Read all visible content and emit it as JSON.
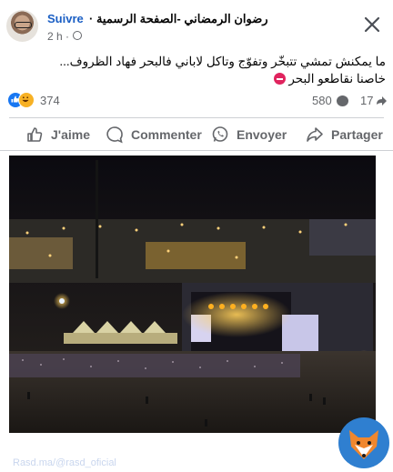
{
  "header": {
    "follow_label": "Suivre",
    "author_name": "رضوان الرمضاني -الصفحة الرسمية ·",
    "time": "2 h ·"
  },
  "post": {
    "line1": "ما يمكنش تمشي تتبخّر وتفوّج وتاكل لاباني فالبحر فهاد الظروف...",
    "line2": "خاصنا نقاطعو البحر"
  },
  "stats": {
    "reactions_count": "374",
    "comments_count": "580",
    "shares_count": "17"
  },
  "actions": {
    "like": "J'aime",
    "comment": "Commenter",
    "send": "Envoyer",
    "share": "Partager"
  },
  "watermark": "Rasd.ma/@rasd_oficial",
  "colors": {
    "link_blue": "#1b5fc4",
    "gray_text": "#65676b",
    "like_blue": "#1877f2",
    "stage_light": "#ffb020"
  }
}
